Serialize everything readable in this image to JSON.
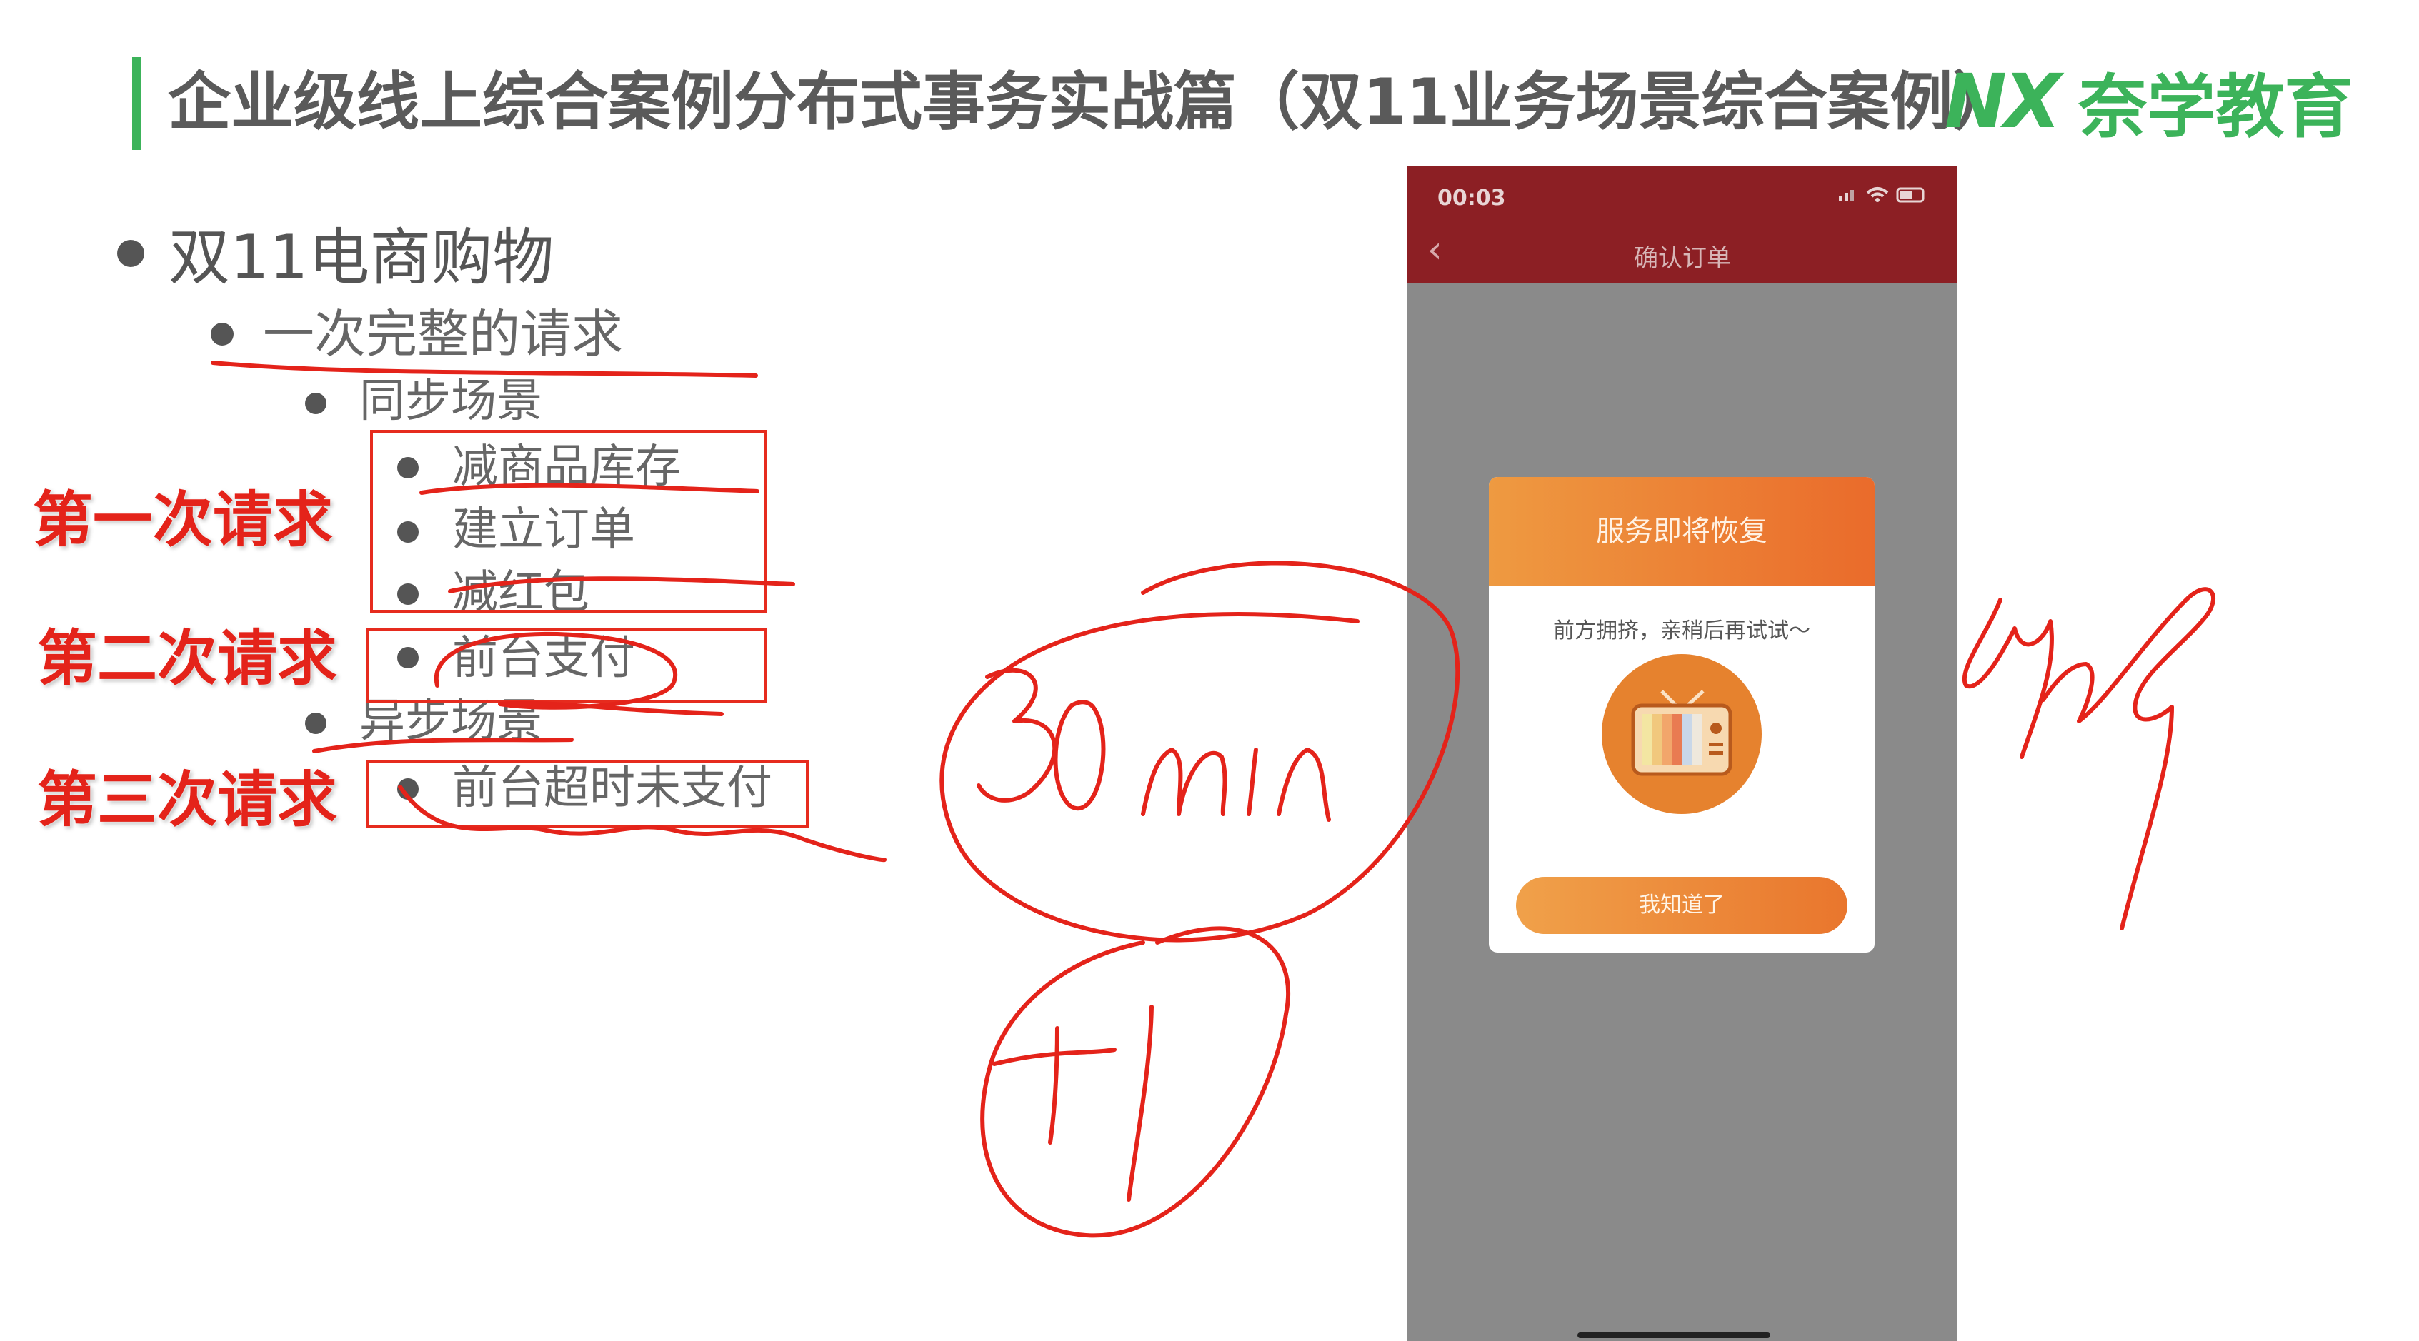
{
  "header": {
    "title": "企业级线上综合案例分布式事务实战篇（双11业务场景综合案例）",
    "brand_mark": "NX",
    "brand_name": "奈学教育",
    "accent_color": "#3cb35a"
  },
  "outline": {
    "level1": "双11电商购物",
    "level2": "一次完整的请求",
    "sync_heading": "同步场景",
    "sync_items": [
      "减商品库存",
      "建立订单",
      "减红包"
    ],
    "pay_item": "前台支付",
    "async_heading": "异步场景",
    "async_items": [
      "前台超时未支付"
    ]
  },
  "request_labels": [
    "第一次请求",
    "第二次请求",
    "第三次请求"
  ],
  "phone": {
    "time": "00:03",
    "nav_title": "确认订单",
    "dialog_title": "服务即将恢复",
    "dialog_message": "前方拥挤，亲稍后再试试～",
    "dialog_button": "我知道了",
    "nav_color": "#8c1f24"
  },
  "annotation_color": "#e4231a"
}
